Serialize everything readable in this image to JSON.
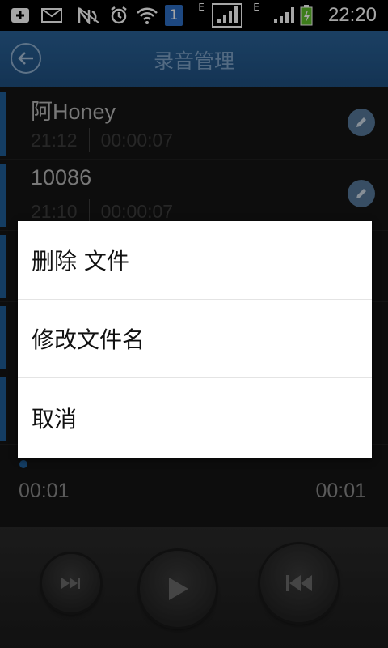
{
  "status_bar": {
    "time": "22:20",
    "sim_badge": "1",
    "network_type_1": "E",
    "network_type_2": "E"
  },
  "header": {
    "title": "录音管理",
    "back_icon": "back-arrow-icon"
  },
  "recordings": [
    {
      "name": "阿Honey",
      "time": "21:12",
      "duration": "00:00:07"
    },
    {
      "name": "10086",
      "time": "21:10",
      "duration": "00:00:07"
    }
  ],
  "dialog": {
    "items": [
      "删除  文件",
      "修改文件名",
      "取消"
    ]
  },
  "player": {
    "elapsed": "00:01",
    "total": "00:01"
  },
  "colors": {
    "header": "#22588c",
    "accent": "#1f5f99",
    "edit_button": "#56789a"
  }
}
